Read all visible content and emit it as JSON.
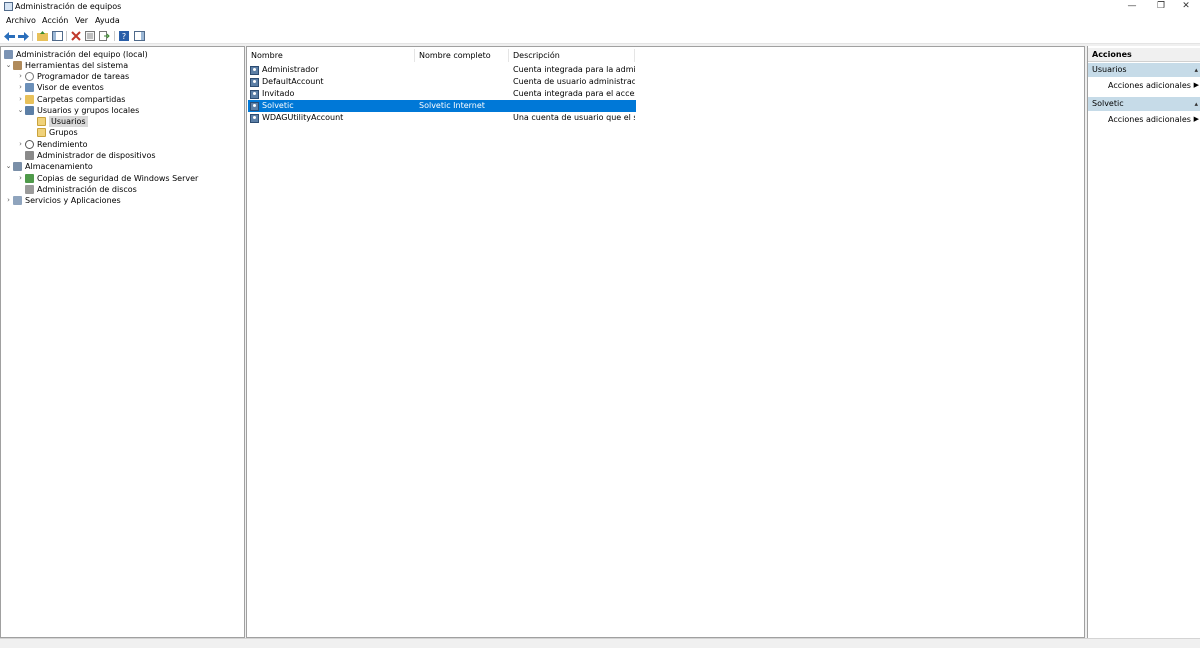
{
  "window": {
    "title": "Administración de equipos",
    "minimize_glyph": "—",
    "restore_glyph": "❐",
    "close_glyph": "✕"
  },
  "menu": [
    "Archivo",
    "Acción",
    "Ver",
    "Ayuda"
  ],
  "toolbar": {
    "buttons": [
      "back-icon",
      "forward-icon",
      "up-folder-icon",
      "show-hide-tree-icon",
      "delete-icon",
      "properties-icon",
      "export-list-icon",
      "help-icon",
      "show-action-pane-icon"
    ]
  },
  "tree": {
    "root": "Administración del equipo (local)",
    "system_tools": "Herramientas del sistema",
    "task_scheduler": "Programador de tareas",
    "event_viewer": "Visor de eventos",
    "shared_folders": "Carpetas compartidas",
    "local_users_groups": "Usuarios y grupos locales",
    "users": "Usuarios",
    "groups": "Grupos",
    "performance": "Rendimiento",
    "device_manager": "Administrador de dispositivos",
    "storage": "Almacenamiento",
    "backup": "Copias de seguridad de Windows Server",
    "disk_management": "Administración de discos",
    "services_apps": "Servicios y Aplicaciones"
  },
  "list": {
    "columns": [
      "Nombre",
      "Nombre completo",
      "Descripción"
    ],
    "rows": [
      {
        "name": "Administrador",
        "full_name": "",
        "description": "Cuenta integrada para la administ...",
        "selected": false
      },
      {
        "name": "DefaultAccount",
        "full_name": "",
        "description": "Cuenta de usuario administrada p...",
        "selected": false
      },
      {
        "name": "Invitado",
        "full_name": "",
        "description": "Cuenta integrada para el acceso c...",
        "selected": false
      },
      {
        "name": "Solvetic",
        "full_name": "Solvetic Internet",
        "description": "",
        "selected": true
      },
      {
        "name": "WDAGUtilityAccount",
        "full_name": "",
        "description": "Una cuenta de usuario que el siste...",
        "selected": false
      }
    ]
  },
  "actions": {
    "header": "Acciones",
    "group1": "Usuarios",
    "group1_item": "Acciones adicionales",
    "group2": "Solvetic",
    "group2_item": "Acciones adicionales"
  },
  "colors": {
    "selection": "#0078d7",
    "action_group_bg": "#c6dbe8"
  }
}
